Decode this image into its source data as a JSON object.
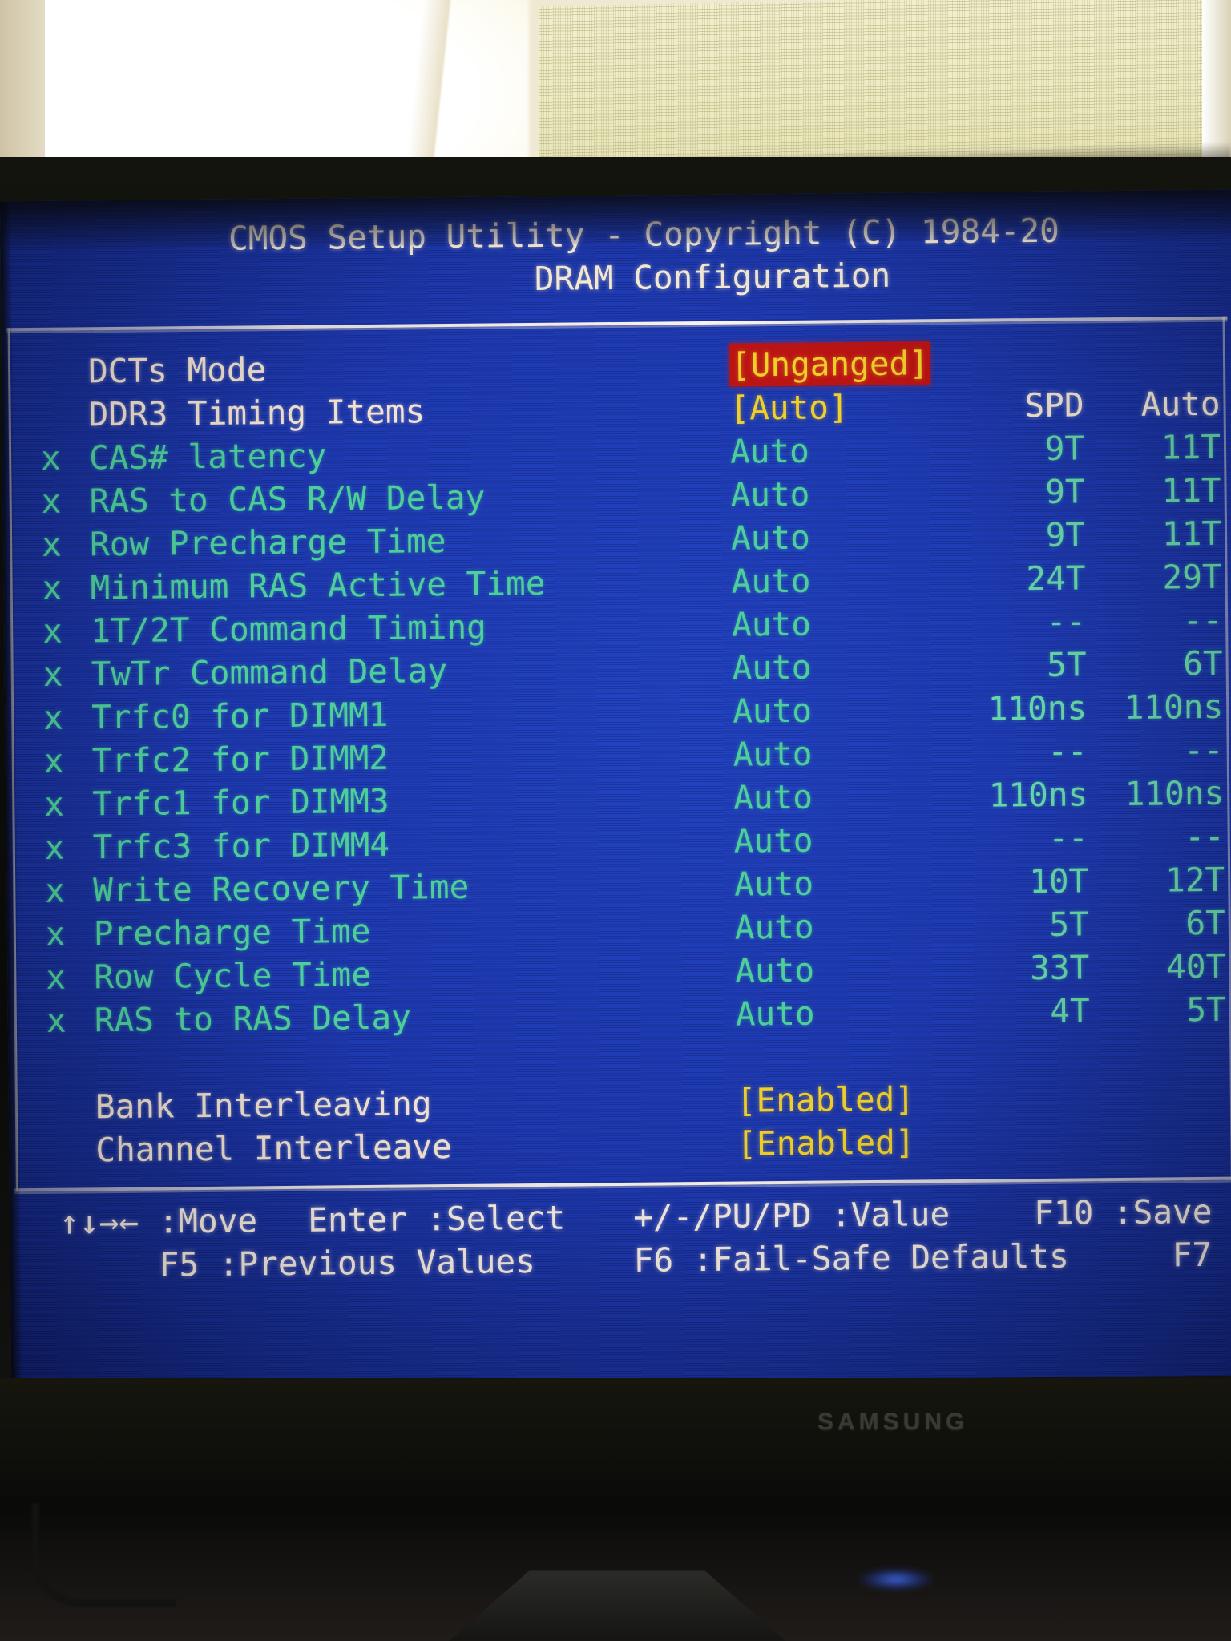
{
  "photo": {
    "monitor_brand": "SAMSUNG"
  },
  "bios": {
    "title_line1": "CMOS Setup Utility - Copyright (C) 1984-20",
    "title_line2": "DRAM Configuration",
    "columns": {
      "spd": "SPD",
      "auto": "Auto"
    },
    "rows": [
      {
        "marker": "",
        "label": "DCTs Mode",
        "value": "[Unganged]",
        "spd": "",
        "auto": "",
        "type": "head",
        "highlight": true
      },
      {
        "marker": "",
        "label": "DDR3 Timing Items",
        "value": "[Auto]",
        "spd": "SPD",
        "auto": "Auto",
        "type": "head",
        "highlight": false,
        "header_row": true
      },
      {
        "marker": "x",
        "label": "CAS# latency",
        "value": "Auto",
        "spd": "9T",
        "auto": "11T",
        "type": "sub"
      },
      {
        "marker": "x",
        "label": "RAS to CAS R/W Delay",
        "value": "Auto",
        "spd": "9T",
        "auto": "11T",
        "type": "sub"
      },
      {
        "marker": "x",
        "label": "Row Precharge Time",
        "value": "Auto",
        "spd": "9T",
        "auto": "11T",
        "type": "sub"
      },
      {
        "marker": "x",
        "label": "Minimum RAS Active Time",
        "value": "Auto",
        "spd": "24T",
        "auto": "29T",
        "type": "sub"
      },
      {
        "marker": "x",
        "label": "1T/2T Command Timing",
        "value": "Auto",
        "spd": "--",
        "auto": "--",
        "type": "sub"
      },
      {
        "marker": "x",
        "label": "TwTr Command Delay",
        "value": "Auto",
        "spd": "5T",
        "auto": "6T",
        "type": "sub"
      },
      {
        "marker": "x",
        "label": "Trfc0 for  DIMM1",
        "value": "Auto",
        "spd": "110ns",
        "auto": "110ns",
        "type": "sub"
      },
      {
        "marker": "x",
        "label": "Trfc2 for  DIMM2",
        "value": "Auto",
        "spd": "--",
        "auto": "--",
        "type": "sub"
      },
      {
        "marker": "x",
        "label": "Trfc1 for  DIMM3",
        "value": "Auto",
        "spd": "110ns",
        "auto": "110ns",
        "type": "sub"
      },
      {
        "marker": "x",
        "label": "Trfc3 for  DIMM4",
        "value": "Auto",
        "spd": "--",
        "auto": "--",
        "type": "sub"
      },
      {
        "marker": "x",
        "label": "Write Recovery Time",
        "value": "Auto",
        "spd": "10T",
        "auto": "12T",
        "type": "sub"
      },
      {
        "marker": "x",
        "label": "Precharge Time",
        "value": "Auto",
        "spd": "5T",
        "auto": "6T",
        "type": "sub"
      },
      {
        "marker": "x",
        "label": "Row Cycle Time",
        "value": "Auto",
        "spd": "33T",
        "auto": "40T",
        "type": "sub"
      },
      {
        "marker": "x",
        "label": "RAS to RAS Delay",
        "value": "Auto",
        "spd": "4T",
        "auto": "5T",
        "type": "sub"
      },
      {
        "marker": "",
        "label": "",
        "value": "",
        "spd": "",
        "auto": "",
        "type": "gap"
      },
      {
        "marker": "",
        "label": "Bank Interleaving",
        "value": "[Enabled]",
        "spd": "",
        "auto": "",
        "type": "head"
      },
      {
        "marker": "",
        "label": "Channel Interleave",
        "value": "[Enabled]",
        "spd": "",
        "auto": "",
        "type": "head"
      }
    ],
    "footer": {
      "move": "↑↓→← :Move",
      "enter": "Enter :Select",
      "value": "+/-/PU/PD :Value",
      "save": "F10 :Save",
      "previous": "F5 :Previous Values",
      "failsafe": "F6 :Fail-Safe Defaults",
      "f7": "F7"
    }
  },
  "colors": {
    "screen_blue": "#1a35ad",
    "highlight_red": "#bb1414",
    "value_yellow": "#f0cf2a",
    "disabled_green": "#4ecf9a",
    "label_white": "#f2e6da"
  }
}
